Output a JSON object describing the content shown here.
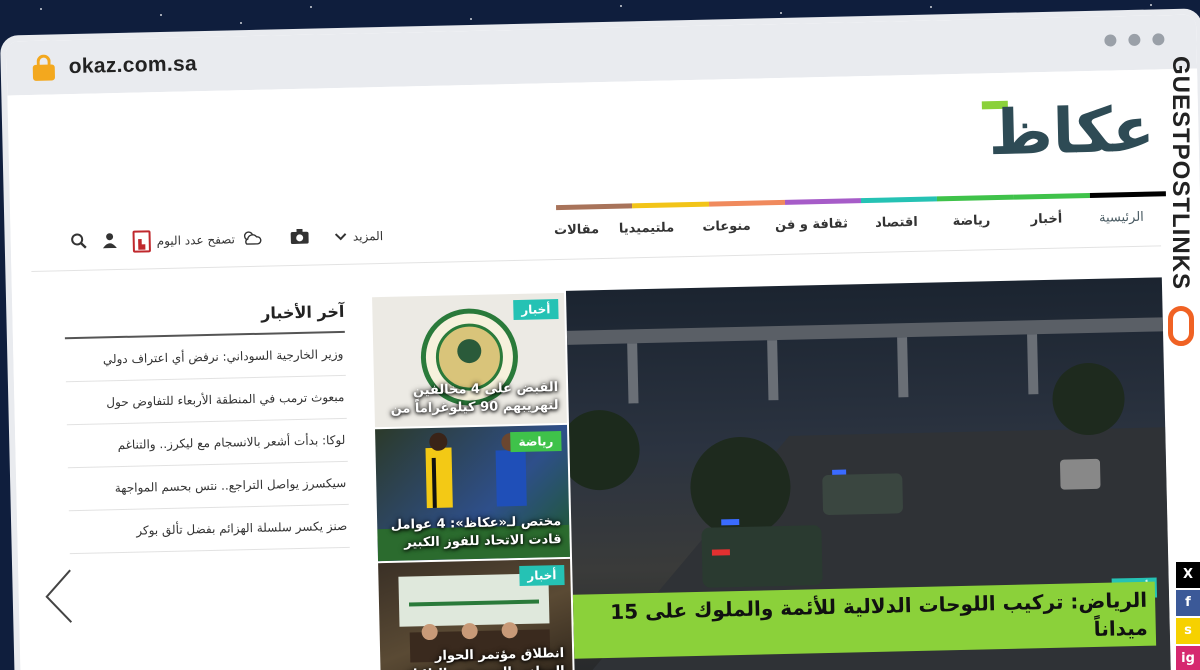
{
  "browser": {
    "url": "okaz.com.sa"
  },
  "logo": {
    "text": "عكاظ"
  },
  "nav": {
    "items": [
      {
        "label": "الرئيسية",
        "color": "#000000"
      },
      {
        "label": "أخبار",
        "color": "#3fc24a"
      },
      {
        "label": "رياضة",
        "color": "#3fc24a"
      },
      {
        "label": "اقتصاد",
        "color": "#25c2b4"
      },
      {
        "label": "ثقافة و فن",
        "color": "#a65cc8"
      },
      {
        "label": "منوعات",
        "color": "#f08a5d"
      },
      {
        "label": "ملتيميديا",
        "color": "#f2c418"
      },
      {
        "label": "مقالات",
        "color": "#a8735a"
      }
    ]
  },
  "tools": {
    "more_label": "المزيد",
    "epaper_label": "تصفح عدد اليوم"
  },
  "latest": {
    "title": "آخر الأخبار",
    "items": [
      "وزير الخارجية السوداني: نرفض أي اعتراف دولي",
      "مبعوث ترمب في المنطقة الأربعاء للتفاوض حول",
      "لوكا: بدأت أشعر بالانسجام مع ليكرز.. والتناغم",
      "سيكسرز يواصل التراجع.. نتس بحسم المواجهة",
      "صنز يكسر سلسلة الهزائم بفضل تألق بوكر"
    ]
  },
  "tiles": {
    "main": {
      "badge": "أخبار",
      "caption": "الرياض: تركيب اللوحات الدلالية للأئمة والملوك على 15 ميداناً"
    },
    "t1": {
      "badge": "أخبار",
      "caption": "القبض على 4 مخالفين لتهريبهم 90 كيلوغراماً من"
    },
    "t2": {
      "badge": "رياضة",
      "caption": "مختص لـ«عكاظ»: 4 عوامل قادت الاتحاد للفوز الكبير"
    },
    "t3": {
      "badge": "أخبار",
      "caption": "انطلاق مؤتمر الحوار الوطني السوري.. الثلاثاء"
    }
  },
  "watermark": {
    "text": "GUESTPOSTLINKS"
  },
  "social": [
    {
      "label": "X",
      "color": "#000000"
    },
    {
      "label": "f",
      "color": "#3b5998"
    },
    {
      "label": "s",
      "color": "#f6d100"
    },
    {
      "label": "ig",
      "color": "#d6286f"
    }
  ]
}
